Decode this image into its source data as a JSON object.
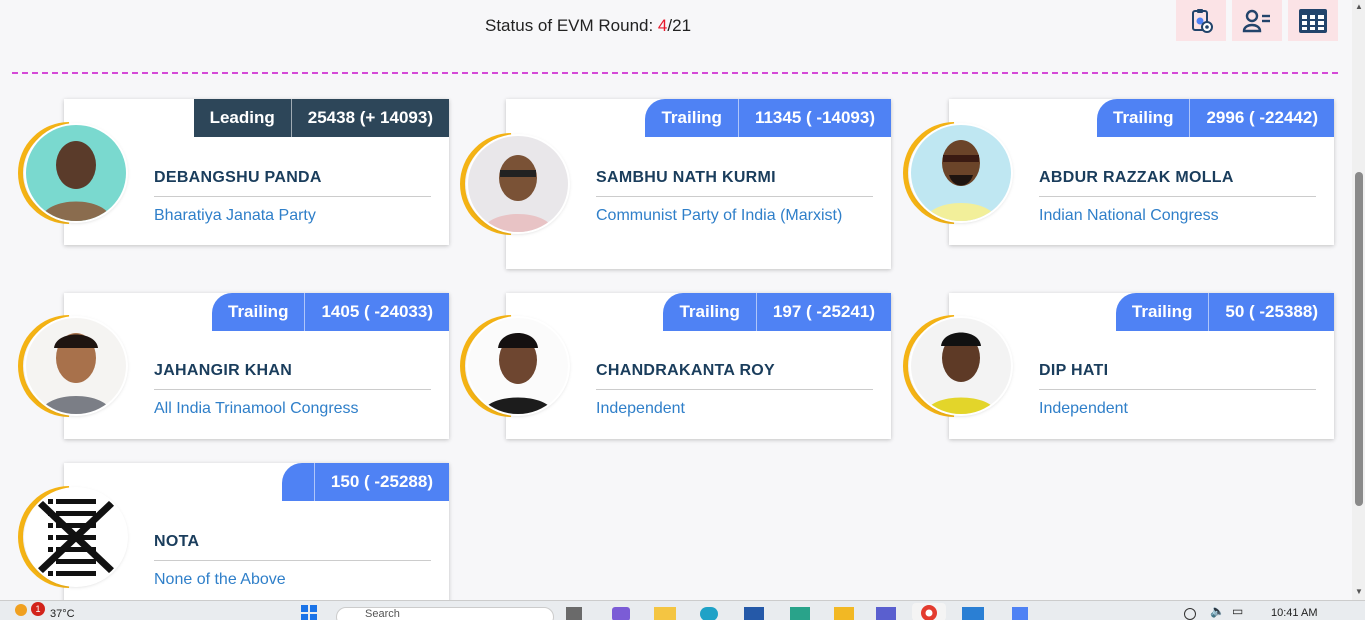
{
  "header": {
    "status_label": "Status of EVM Round: ",
    "current_round": "4",
    "total_rounds": "/21"
  },
  "top_icons": [
    "report-icon",
    "candidate-list-icon",
    "table-grid-icon"
  ],
  "colors": {
    "leading": "#2d4659",
    "trailing": "#4f82f4",
    "accent_arc": "#f4b315",
    "name": "#1a3d5c",
    "party": "#2f7fc9"
  },
  "candidates": [
    {
      "status": "Leading",
      "votes": "25438 (+ 14093)",
      "name": "DEBANGSHU PANDA",
      "party": "Bharatiya Janata Party"
    },
    {
      "status": "Trailing",
      "votes": "11345 ( -14093)",
      "name": "SAMBHU NATH KURMI",
      "party": "Communist Party of India (Marxist)"
    },
    {
      "status": "Trailing",
      "votes": "2996 ( -22442)",
      "name": "ABDUR RAZZAK MOLLA",
      "party": "Indian National Congress"
    },
    {
      "status": "Trailing",
      "votes": "1405 ( -24033)",
      "name": "JAHANGIR KHAN",
      "party": "All India Trinamool Congress"
    },
    {
      "status": "Trailing",
      "votes": "197 ( -25241)",
      "name": "CHANDRAKANTA ROY",
      "party": "Independent"
    },
    {
      "status": "Trailing",
      "votes": "50 ( -25388)",
      "name": "DIP HATI",
      "party": "Independent"
    },
    {
      "status": "",
      "votes": "150 ( -25288)",
      "name": "NOTA",
      "party": "None of the Above"
    }
  ],
  "taskbar": {
    "notification_count": "1",
    "temperature": "37°C",
    "search_placeholder": "Search",
    "time": "10:41 AM"
  }
}
